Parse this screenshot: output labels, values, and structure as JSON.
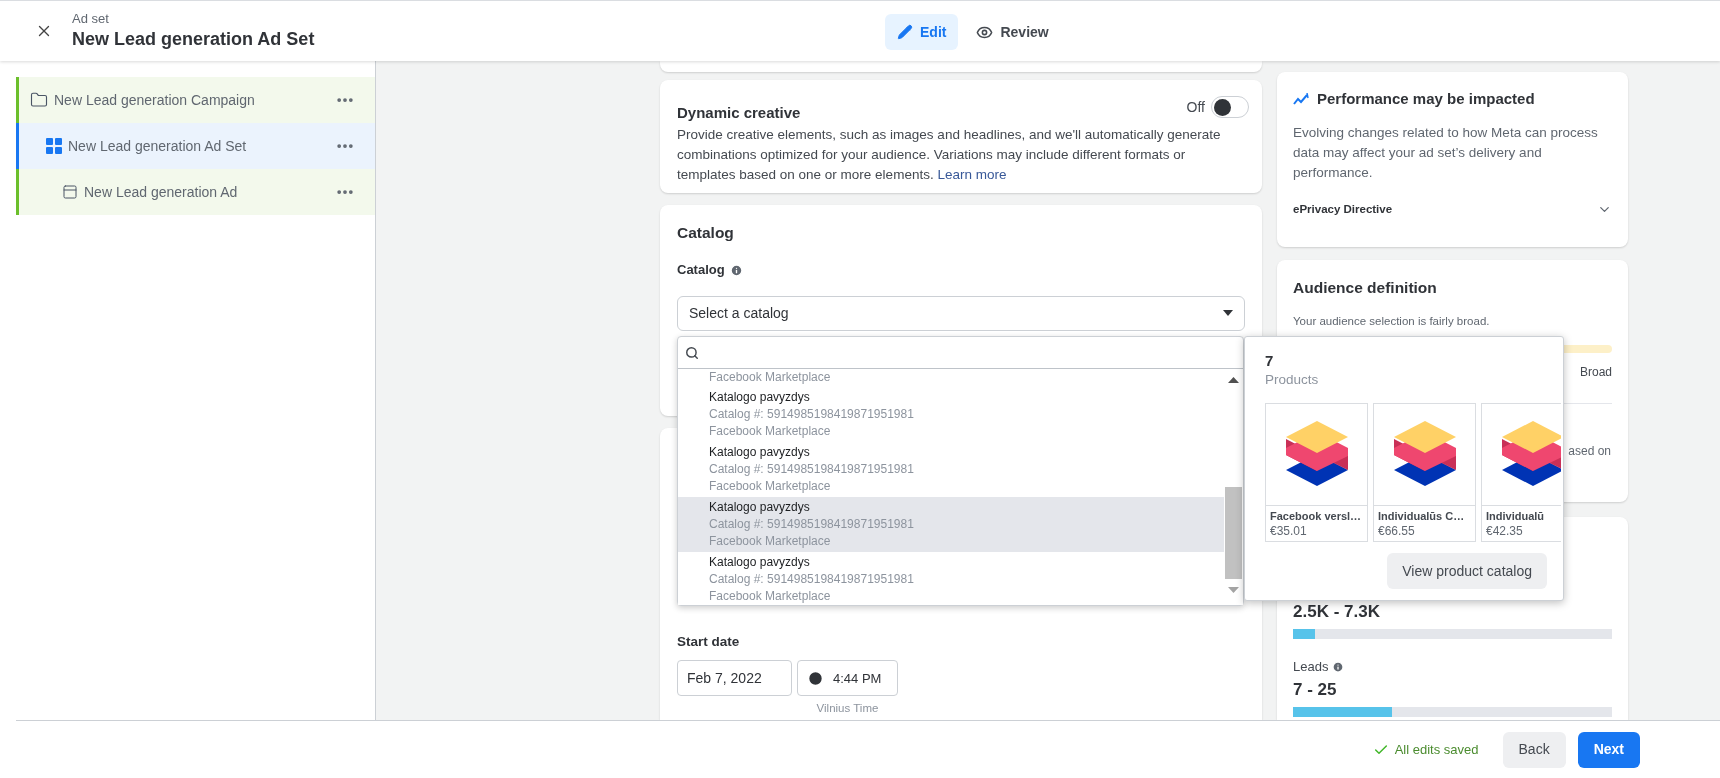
{
  "header": {
    "subtitle": "Ad set",
    "title": "New Lead generation Ad Set",
    "tabs": [
      {
        "label": "Edit",
        "kind": "edit",
        "selected": true
      },
      {
        "label": "Review",
        "kind": "review",
        "selected": false
      }
    ]
  },
  "sidebar": {
    "items": [
      {
        "label": "New Lead generation Campaign",
        "kind": "campaign",
        "selected": false,
        "children": [
          {
            "label": "New Lead generation Ad Set",
            "kind": "adset",
            "selected": true,
            "children": [
              {
                "label": "New Lead generation Ad",
                "kind": "ad",
                "selected": false
              }
            ]
          }
        ]
      }
    ]
  },
  "dynamic_creative": {
    "title": "Dynamic creative",
    "description": "Provide creative elements, such as images and headlines, and we'll automatically generate combinations optimized for your audience. Variations may include different formats or templates based on one or more elements.",
    "link": "Learn more",
    "toggle_label": "Off",
    "on": false
  },
  "catalog": {
    "title": "Catalog",
    "label": "Catalog",
    "select_placeholder": "Select a catalog",
    "dropdown": {
      "items": [
        {
          "marketplace": "Facebook Marketplace",
          "selected": false
        },
        {
          "name": "Katalogo pavyzdys",
          "catalog_number": "Catalog #: 5914985198419871951981",
          "marketplace": "Facebook Marketplace",
          "selected": false
        },
        {
          "name": "Katalogo pavyzdys",
          "catalog_number": "Catalog #: 5914985198419871951981",
          "marketplace": "Facebook Marketplace",
          "selected": false
        },
        {
          "name": "Katalogo pavyzdys",
          "catalog_number": "Catalog #: 5914985198419871951981",
          "marketplace": "Facebook Marketplace",
          "selected": true
        },
        {
          "name": "Katalogo pavyzdys",
          "catalog_number": "Catalog #: 5914985198419871951981",
          "marketplace": "Facebook Marketplace",
          "selected": false
        }
      ]
    }
  },
  "schedule": {
    "label": "Start date",
    "date": "Feb 7, 2022",
    "time": "4:44 PM",
    "timezone": "Vilnius Time"
  },
  "product_popover": {
    "count": "7",
    "count_label": "Products",
    "products": [
      {
        "name": "Facebook versl…",
        "price": "€35.01"
      },
      {
        "name": "Individualūs C…",
        "price": "€66.55"
      },
      {
        "name": "Individualū",
        "price": "€42.35"
      }
    ],
    "button": "View product catalog"
  },
  "performance": {
    "title": "Performance may be impacted",
    "text": "Evolving changes related to how Meta can process data may affect your ad set’s delivery and performance.",
    "section": "ePrivacy Directive",
    "expanded": false
  },
  "audience": {
    "title": "Audience definition",
    "text": "Your audience selection is fairly broad.",
    "breadth_label": "Broad",
    "note_fragment": "ased on"
  },
  "estimates": [
    {
      "value": "2.5K - 7.3K",
      "level": 0.07
    },
    {
      "label": "Leads",
      "value": "7 - 25",
      "level": 0.31
    }
  ],
  "footer": {
    "status": "All edits saved",
    "buttons": [
      {
        "label": "Back",
        "kind": "secondary"
      },
      {
        "label": "Next",
        "kind": "primary"
      }
    ]
  }
}
